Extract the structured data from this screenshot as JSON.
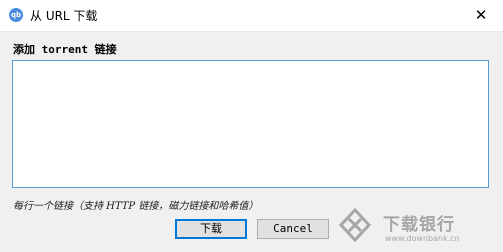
{
  "window": {
    "title": "从 URL 下载",
    "app_icon_text": "qb",
    "close_glyph": "✕"
  },
  "form": {
    "prompt_label": "添加 torrent 链接",
    "textarea_value": "",
    "hint": "每行一个链接（支持 HTTP 链接，磁力链接和哈希值）"
  },
  "buttons": {
    "download_label": "下载",
    "cancel_label": "Cancel"
  },
  "watermark": {
    "name": "下载银行",
    "url": "www.downbank.cn"
  },
  "colors": {
    "accent": "#0078d7",
    "textarea_border": "#5b9bd5",
    "app_icon": "#4a8de0"
  }
}
